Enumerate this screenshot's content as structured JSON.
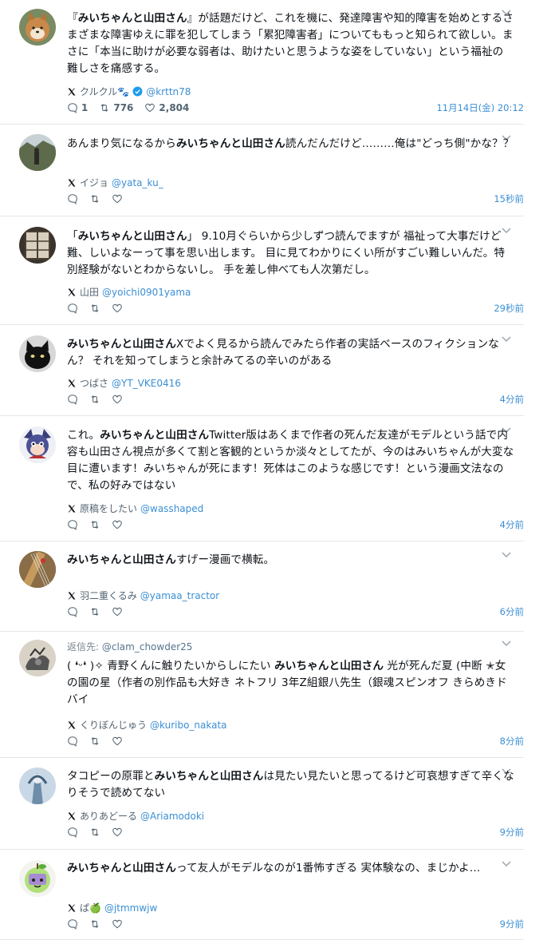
{
  "tweets": [
    {
      "text_segments": [
        {
          "t": "『"
        },
        {
          "t": "みいちゃんと山田さん",
          "b": true
        },
        {
          "t": "』が話題だけど、これを機に、発達障害や知的障害を始めとするさまざまな障害ゆえに罪を犯してしまう「累犯障害者」についてももっと知られて欲しい。まさに「本当に助けが必要な弱者は、助けたいと思うような姿をしていない」という福祉の難しさを痛感する。"
        }
      ],
      "author_name": "クルクル🐾",
      "verified": true,
      "handle": "@krttn78",
      "replies": "1",
      "retweets": "776",
      "likes": "2,804",
      "time": "11月14日(金) 20:12",
      "avatar_icon": "shiba-dog-avatar"
    },
    {
      "text_segments": [
        {
          "t": "あんまり気になるから"
        },
        {
          "t": "みいちゃんと山田さん",
          "b": true
        },
        {
          "t": "読んだんだけど………俺は\"どっち側\"かな？？"
        }
      ],
      "author_name": "イジョ",
      "handle": "@yata_ku_",
      "time": "15秒前",
      "avatar_icon": "outdoor-photo-avatar"
    },
    {
      "text_segments": [
        {
          "t": "「"
        },
        {
          "t": "みいちゃんと山田さん",
          "b": true
        },
        {
          "t": "」 9.10月ぐらいから少しずつ読んでますが 福祉って大事だけど難、しいよなーって事を思い出します。 目に見てわかりにくい所がすごい難しいんだ。特別経験がないとわからないし。 手を差し伸べても人次第だし。"
        }
      ],
      "author_name": "山田",
      "handle": "@yoichi0901yama",
      "time": "29秒前",
      "avatar_icon": "window-photo-avatar"
    },
    {
      "text_segments": [
        {
          "t": "みいちゃんと山田さん",
          "b": true
        },
        {
          "t": "Xでよく見るから読んでみたら作者の実話ベースのフィクションなん？ それを知ってしまうと余計みてるの辛いのがある"
        }
      ],
      "author_name": "つばさ",
      "handle": "@YT_VKE0416",
      "time": "4分前",
      "avatar_icon": "black-cat-avatar"
    },
    {
      "text_segments": [
        {
          "t": "これ。"
        },
        {
          "t": "みいちゃんと山田さん",
          "b": true
        },
        {
          "t": "Twitter版はあくまで作者の死んだ友達がモデルという話で内容も山田さん視点が多くて割と客観的というか淡々としてたが、今のはみいちゃんが大変な目に遭います！みいちゃんが死にます！死体はこのような感じです！という漫画文法なので、私の好みではない"
        }
      ],
      "author_name": "原稿をしたい",
      "handle": "@wasshaped",
      "time": "4分前",
      "avatar_icon": "cartoon-character-avatar"
    },
    {
      "text_segments": [
        {
          "t": "みいちゃんと山田さん",
          "b": true
        },
        {
          "t": "すげー漫画で横転。"
        }
      ],
      "author_name": "羽二重くるみ",
      "handle": "@yamaa_tractor",
      "time": "6分前",
      "avatar_icon": "guitar-photo-avatar"
    },
    {
      "reply_to_label": "返信先:",
      "reply_to_handle": "@clam_chowder25",
      "text_segments": [
        {
          "t": "( ❛ᵕ❛ )✧ 青野くんに触りたいからしにたい "
        },
        {
          "t": "みいちゃんと山田さん",
          "b": true
        },
        {
          "t": " 光が死んだ夏 (中断 ✭女の園の星（作者の別作品も大好き ネトフリ 3年Z組銀八先生（銀魂スピンオフ きらめきドバイ"
        }
      ],
      "author_name": "くりぼんじゅう",
      "handle": "@kuribo_nakata",
      "time": "8分前",
      "avatar_icon": "sketch-avatar"
    },
    {
      "text_segments": [
        {
          "t": "タコピーの原罪と"
        },
        {
          "t": "みいちゃんと山田さん",
          "b": true
        },
        {
          "t": "は見たい見たいと思ってるけど可哀想すぎて辛くなりそうで読めてない"
        }
      ],
      "author_name": "ありあどーる",
      "handle": "@Ariamodoki",
      "time": "9分前",
      "avatar_icon": "illustration-avatar"
    },
    {
      "text_segments": [
        {
          "t": "みいちゃんと山田さん",
          "b": true
        },
        {
          "t": "って友人がモデルなのが1番怖すぎる 実体験なの、まじかよ…"
        }
      ],
      "author_name": "ぱ🍏",
      "handle": "@jtmmwjw",
      "time": "9分前",
      "avatar_icon": "apple-character-avatar"
    }
  ],
  "colors": {
    "text": "#0f1419",
    "muted": "#536471",
    "link": "#3b8fd4",
    "verified": "#1d9bf0",
    "divider": "#e6e6e6"
  }
}
